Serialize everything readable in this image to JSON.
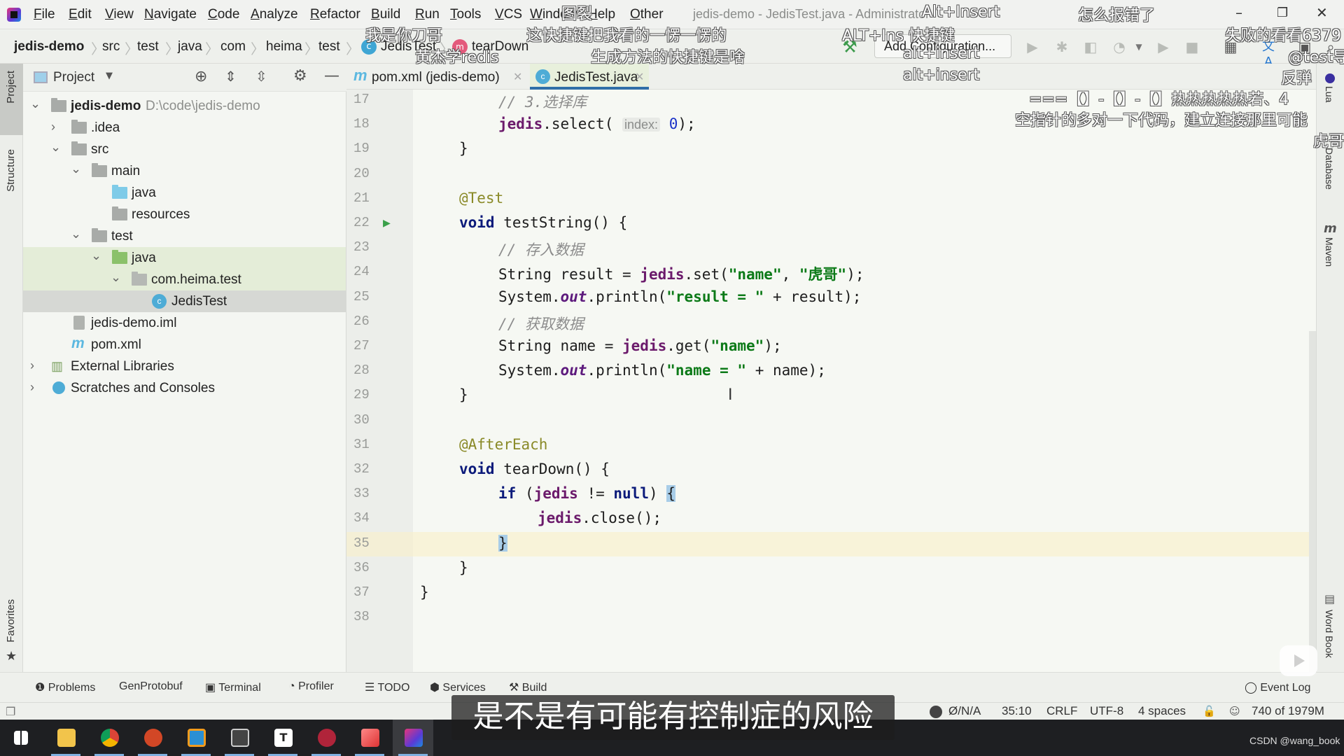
{
  "menubar": {
    "items": [
      "File",
      "Edit",
      "View",
      "Navigate",
      "Code",
      "Analyze",
      "Refactor",
      "Build",
      "Run",
      "Tools",
      "VCS",
      "Window",
      "Help",
      "Other"
    ],
    "window_title": "jedis-demo - JedisTest.java - Administrator",
    "controls": {
      "minimize": "–",
      "restore": "❐",
      "close": "✕"
    }
  },
  "navbar": {
    "breadcrumbs": [
      "jedis-demo",
      "src",
      "test",
      "java",
      "com",
      "heima",
      "test",
      "JedisTest",
      "tearDown"
    ],
    "run_config": "Add Configuration...",
    "icons": [
      "build-hammer-icon",
      "run-icon",
      "debug-icon",
      "coverage-icon",
      "profile-icon",
      "dropdown-icon",
      "run-any-icon",
      "stop-icon",
      "project-structure-icon",
      "translate-icon",
      "vcs-icon",
      "search-icon"
    ]
  },
  "left_strip": {
    "tabs": [
      "Project",
      "Structure",
      "Favorites"
    ]
  },
  "project_panel": {
    "title": "Project",
    "tree": [
      {
        "label": "jedis-demo",
        "path": "D:\\code\\jedis-demo",
        "expanded": true,
        "icon": "module-folder-icon"
      },
      {
        "label": ".idea",
        "expanded": false,
        "icon": "folder-icon"
      },
      {
        "label": "src",
        "expanded": true,
        "icon": "folder-icon"
      },
      {
        "label": "main",
        "expanded": true,
        "icon": "folder-icon"
      },
      {
        "label": "java",
        "icon": "source-folder-icon"
      },
      {
        "label": "resources",
        "icon": "resources-folder-icon"
      },
      {
        "label": "test",
        "expanded": true,
        "icon": "folder-icon"
      },
      {
        "label": "java",
        "expanded": true,
        "icon": "test-folder-icon"
      },
      {
        "label": "com.heima.test",
        "expanded": true,
        "icon": "package-icon"
      },
      {
        "label": "JedisTest",
        "icon": "class-icon",
        "selected": true
      },
      {
        "label": "jedis-demo.iml",
        "icon": "iml-file-icon"
      },
      {
        "label": "pom.xml",
        "icon": "maven-icon"
      },
      {
        "label": "External Libraries",
        "expanded": false,
        "icon": "libraries-icon"
      },
      {
        "label": "Scratches and Consoles",
        "expanded": false,
        "icon": "scratches-icon"
      }
    ]
  },
  "editor": {
    "tabs": [
      {
        "label": "pom.xml (jedis-demo)",
        "active": false
      },
      {
        "label": "JedisTest.java",
        "active": true
      }
    ],
    "lines": [
      {
        "n": "17",
        "indent": 2,
        "tokens": [
          [
            "cmt",
            "// 3.选择库"
          ]
        ]
      },
      {
        "n": "18",
        "indent": 2,
        "tokens": [
          [
            "fld",
            "jedis"
          ],
          [
            "",
            ".select( "
          ],
          [
            "hint",
            "index:"
          ],
          [
            "",
            " "
          ],
          [
            "num",
            "0"
          ],
          [
            "",
            ");"
          ]
        ]
      },
      {
        "n": "19",
        "indent": 1,
        "tokens": [
          [
            "",
            "}"
          ]
        ]
      },
      {
        "n": "20",
        "indent": 0,
        "tokens": []
      },
      {
        "n": "21",
        "indent": 1,
        "tokens": [
          [
            "ann",
            "@Test"
          ]
        ]
      },
      {
        "n": "22",
        "indent": 1,
        "tokens": [
          [
            "kw",
            "void"
          ],
          [
            "",
            " testString() {"
          ]
        ]
      },
      {
        "n": "23",
        "indent": 2,
        "tokens": [
          [
            "cmt",
            "// 存入数据"
          ]
        ]
      },
      {
        "n": "24",
        "indent": 2,
        "tokens": [
          [
            "",
            "String result = "
          ],
          [
            "fld",
            "jedis"
          ],
          [
            "",
            ".set("
          ],
          [
            "str",
            "\"name\""
          ],
          [
            "",
            ", "
          ],
          [
            "str",
            "\"虎哥\""
          ],
          [
            "",
            ");"
          ]
        ]
      },
      {
        "n": "25",
        "indent": 2,
        "tokens": [
          [
            "",
            "System."
          ],
          [
            "sf",
            "out"
          ],
          [
            "",
            ".println("
          ],
          [
            "str",
            "\"result = \""
          ],
          [
            "",
            " + result);"
          ]
        ]
      },
      {
        "n": "26",
        "indent": 2,
        "tokens": [
          [
            "cmt",
            "// 获取数据"
          ]
        ]
      },
      {
        "n": "27",
        "indent": 2,
        "tokens": [
          [
            "",
            "String name = "
          ],
          [
            "fld",
            "jedis"
          ],
          [
            "",
            ".get("
          ],
          [
            "str",
            "\"name\""
          ],
          [
            "",
            ");"
          ]
        ]
      },
      {
        "n": "28",
        "indent": 2,
        "tokens": [
          [
            "",
            "System."
          ],
          [
            "sf",
            "out"
          ],
          [
            "",
            ".println("
          ],
          [
            "str",
            "\"name = \""
          ],
          [
            "",
            " + name);"
          ]
        ]
      },
      {
        "n": "29",
        "indent": 1,
        "tokens": [
          [
            "",
            "}"
          ]
        ]
      },
      {
        "n": "30",
        "indent": 0,
        "tokens": []
      },
      {
        "n": "31",
        "indent": 1,
        "tokens": [
          [
            "ann",
            "@AfterEach"
          ]
        ]
      },
      {
        "n": "32",
        "indent": 1,
        "tokens": [
          [
            "kw",
            "void"
          ],
          [
            "",
            " tearDown() {"
          ]
        ]
      },
      {
        "n": "33",
        "indent": 2,
        "tokens": [
          [
            "kw",
            "if"
          ],
          [
            "",
            " ("
          ],
          [
            "fld",
            "jedis"
          ],
          [
            "",
            " != "
          ],
          [
            "kw",
            "null"
          ],
          [
            "",
            ") "
          ],
          [
            "brace-hl",
            "{"
          ]
        ]
      },
      {
        "n": "34",
        "indent": 3,
        "tokens": [
          [
            "fld",
            "jedis"
          ],
          [
            "",
            ".close();"
          ]
        ]
      },
      {
        "n": "35",
        "indent": 2,
        "tokens": [
          [
            "brace-hl",
            "}"
          ]
        ],
        "current": true
      },
      {
        "n": "36",
        "indent": 1,
        "tokens": [
          [
            "",
            "}"
          ]
        ]
      },
      {
        "n": "37",
        "indent": 0,
        "tokens": [
          [
            "",
            "}"
          ]
        ]
      },
      {
        "n": "38",
        "indent": 0,
        "tokens": []
      }
    ]
  },
  "right_strip": {
    "tabs": [
      "Lua",
      "Database",
      "Maven",
      "Word Book"
    ]
  },
  "bottom_tools": [
    {
      "label": "Problems",
      "icon": "problems-icon"
    },
    {
      "label": "GenProtobuf",
      "icon": ""
    },
    {
      "label": "Terminal",
      "icon": "terminal-icon"
    },
    {
      "label": "Profiler",
      "icon": "profiler-icon"
    },
    {
      "label": "TODO",
      "icon": "todo-icon"
    },
    {
      "label": "Services",
      "icon": "services-icon"
    },
    {
      "label": "Build",
      "icon": "build-icon"
    }
  ],
  "event_log": "Event Log",
  "status": {
    "vcs": "Ø/N/A",
    "position": "35:10",
    "line_sep": "CRLF",
    "encoding": "UTF-8",
    "indent": "4 spaces",
    "memory": "740 of 1979M"
  },
  "taskbar": {
    "apps": [
      "windows-start-icon",
      "file-explorer-icon",
      "chrome-icon",
      "powerpoint-icon",
      "virtualbox-icon",
      "terminal-app-icon",
      "typora-icon",
      "redis-desktop-icon",
      "eraser-app-icon",
      "intellij-icon"
    ]
  },
  "overlay": {
    "subtitle": "是不是有可能有控制症的风险",
    "watermark": "CSDN @wang_book",
    "danmaku": [
      "图裂",
      "我是你刀哥",
      "这快捷键把我看的一愣一愣的",
      "黄杰学redis",
      "生成方法的快捷键是啥",
      "Alt+Insert",
      "ALT+Ins 快捷键",
      "alt+insert",
      "alt+insert",
      "怎么报错了",
      "失败的看看6379",
      "@test导",
      "反弹",
      "===【】-【】-【】热热热热热若、4",
      "空指针的多对一下代码，建立连接那里可能",
      "虎哥"
    ]
  }
}
